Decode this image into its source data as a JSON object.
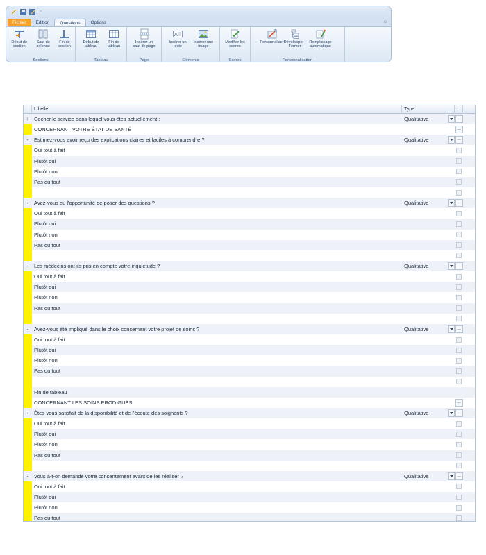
{
  "ribbon": {
    "tabs": [
      {
        "label": "Fichier",
        "kind": "file"
      },
      {
        "label": "Edition",
        "kind": "normal"
      },
      {
        "label": "Questions",
        "kind": "active"
      },
      {
        "label": "Options",
        "kind": "normal"
      }
    ],
    "groups": [
      {
        "label": "Sections",
        "buttons": [
          "Début de section",
          "Saut de colonne",
          "Fin de section"
        ]
      },
      {
        "label": "Tableau",
        "buttons": [
          "Début de tableau",
          "Fin de tableau"
        ]
      },
      {
        "label": "Page",
        "buttons": [
          "Insérer un saut de page"
        ]
      },
      {
        "label": "Eléments",
        "buttons": [
          "Insérer un texte",
          "Insérer une image"
        ]
      },
      {
        "label": "Scores",
        "buttons": [
          "Modifier les scores"
        ]
      },
      {
        "label": "Personnalisation",
        "buttons": [
          "Personnaliser",
          "Développer / Fermer",
          "Remplissage automatique"
        ]
      }
    ]
  },
  "grid": {
    "columns": {
      "label": "Libellé",
      "type": "Type",
      "action": "..."
    },
    "rows": [
      {
        "marker": "+",
        "label": "Cocher le service dans lequel vous êtes actuellement :",
        "type": "Qualitative",
        "kind": "question"
      },
      {
        "marker": "",
        "label": "CONCERNANT VOTRE ÉTAT DE SANTÉ",
        "type": "",
        "kind": "section"
      },
      {
        "marker": "-",
        "label": "Estimez-vous avoir reçu des explications claires et faciles à comprendre ?",
        "type": "Qualitative",
        "kind": "question"
      },
      {
        "marker": "",
        "label": "Oui tout à fait",
        "type": "",
        "kind": "answer"
      },
      {
        "marker": "",
        "label": "Plutôt oui",
        "type": "",
        "kind": "answer"
      },
      {
        "marker": "",
        "label": "Plutôt non",
        "type": "",
        "kind": "answer"
      },
      {
        "marker": "",
        "label": "Pas du tout",
        "type": "",
        "kind": "answer"
      },
      {
        "marker": "",
        "label": "",
        "type": "",
        "kind": "blank"
      },
      {
        "marker": "-",
        "label": "Avez-vous eu l'opportunité de poser des questions ?",
        "type": "Qualitative",
        "kind": "question"
      },
      {
        "marker": "",
        "label": "Oui tout à fait",
        "type": "",
        "kind": "answer"
      },
      {
        "marker": "",
        "label": "Plutôt oui",
        "type": "",
        "kind": "answer"
      },
      {
        "marker": "",
        "label": "Plutôt non",
        "type": "",
        "kind": "answer"
      },
      {
        "marker": "",
        "label": "Pas du tout",
        "type": "",
        "kind": "answer"
      },
      {
        "marker": "",
        "label": "",
        "type": "",
        "kind": "blank"
      },
      {
        "marker": "-",
        "label": "Les médecins ont-ils pris en compte votre inquiétude ?",
        "type": "Qualitative",
        "kind": "question"
      },
      {
        "marker": "",
        "label": "Oui tout à fait",
        "type": "",
        "kind": "answer"
      },
      {
        "marker": "",
        "label": "Plutôt oui",
        "type": "",
        "kind": "answer"
      },
      {
        "marker": "",
        "label": "Plutôt non",
        "type": "",
        "kind": "answer"
      },
      {
        "marker": "",
        "label": "Pas du tout",
        "type": "",
        "kind": "answer"
      },
      {
        "marker": "",
        "label": "",
        "type": "",
        "kind": "blank"
      },
      {
        "marker": "-",
        "label": "Avez-vous été impliqué dans le choix concernant votre projet de soins ?",
        "type": "Qualitative",
        "kind": "question"
      },
      {
        "marker": "",
        "label": "Oui tout à fait",
        "type": "",
        "kind": "answer"
      },
      {
        "marker": "",
        "label": "Plutôt oui",
        "type": "",
        "kind": "answer"
      },
      {
        "marker": "",
        "label": "Plutôt non",
        "type": "",
        "kind": "answer"
      },
      {
        "marker": "",
        "label": "Pas du tout",
        "type": "",
        "kind": "answer"
      },
      {
        "marker": "",
        "label": "",
        "type": "",
        "kind": "blank"
      },
      {
        "marker": "",
        "label": "Fin de tableau",
        "type": "",
        "kind": "table-end"
      },
      {
        "marker": "",
        "label": "CONCERNANT LES SOINS PRODIGUÉS",
        "type": "",
        "kind": "section"
      },
      {
        "marker": "-",
        "label": "Êtes-vous satisfait de la disponibilité et de l'écoute des soignants  ?",
        "type": "Qualitative",
        "kind": "question"
      },
      {
        "marker": "",
        "label": "Oui tout à fait",
        "type": "",
        "kind": "answer"
      },
      {
        "marker": "",
        "label": "Plutôt oui",
        "type": "",
        "kind": "answer"
      },
      {
        "marker": "",
        "label": "Plutôt non",
        "type": "",
        "kind": "answer"
      },
      {
        "marker": "",
        "label": "Pas du tout",
        "type": "",
        "kind": "answer"
      },
      {
        "marker": "",
        "label": "",
        "type": "",
        "kind": "blank"
      },
      {
        "marker": "-",
        "label": "Vous a-t-on demandé votre consentement avant de les réaliser ?",
        "type": "Qualitative",
        "kind": "question"
      },
      {
        "marker": "",
        "label": "Oui tout à fait",
        "type": "",
        "kind": "answer"
      },
      {
        "marker": "",
        "label": "Plutôt oui",
        "type": "",
        "kind": "answer"
      },
      {
        "marker": "",
        "label": "Plutôt non",
        "type": "",
        "kind": "answer"
      },
      {
        "marker": "",
        "label": "Pas du tout",
        "type": "",
        "kind": "answer"
      }
    ]
  },
  "colors": {
    "marker_yellow": "#fff100",
    "row_alt": "#eef2f8",
    "file_tab": "#f6a128"
  }
}
